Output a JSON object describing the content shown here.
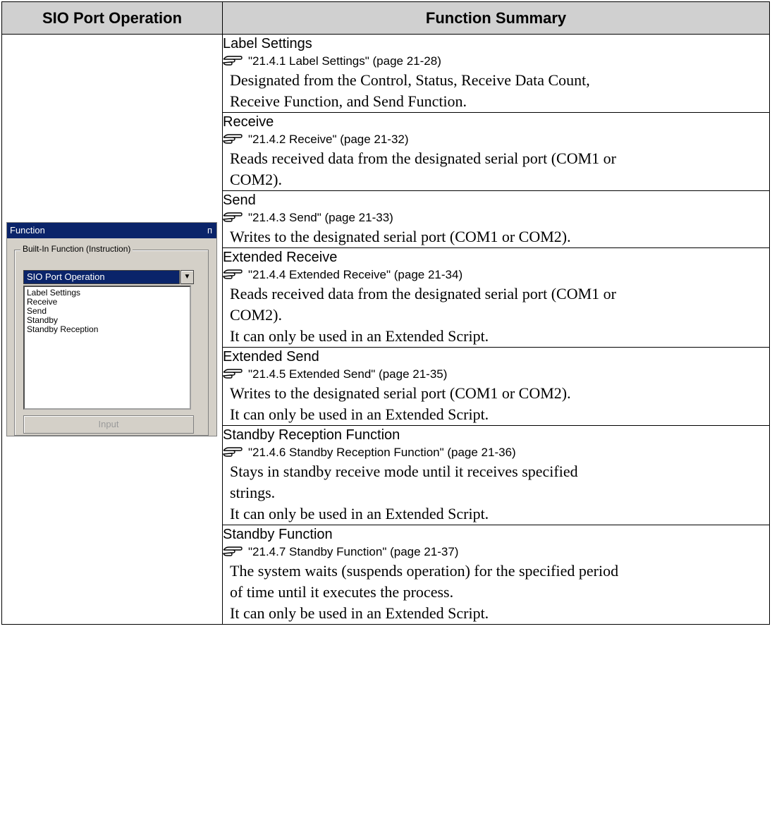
{
  "header": {
    "col1": "SIO Port Operation",
    "col2": "Function Summary"
  },
  "panel": {
    "title": "Function",
    "pin_glyph": "ᴨ",
    "group_label": "Built-In Function (Instruction)",
    "combo_value": "SIO Port Operation",
    "list_items": [
      "Label Settings",
      "Receive",
      "Send",
      "Standby",
      "Standby Reception"
    ],
    "input_button": "Input"
  },
  "rows": [
    {
      "name": "Label Settings",
      "ref": "\"21.4.1 Label Settings\" (page 21-28)",
      "lines": [
        "Designated from the Control, Status, Receive Data Count,",
        "Receive Function, and Send Function."
      ]
    },
    {
      "name": "Receive",
      "ref": "\"21.4.2 Receive\" (page 21-32)",
      "lines": [
        "Reads received data from the designated serial port (COM1 or",
        "COM2)."
      ]
    },
    {
      "name": "Send",
      "ref": "\"21.4.3 Send\" (page 21-33)",
      "lines": [
        "Writes to the designated serial port (COM1 or COM2)."
      ]
    },
    {
      "name": "Extended Receive",
      "ref": "\"21.4.4 Extended Receive\" (page 21-34)",
      "lines": [
        "Reads received data from the designated serial port (COM1 or",
        "COM2).",
        "It can only be used in an Extended Script."
      ]
    },
    {
      "name": "Extended Send",
      "ref": "\"21.4.5 Extended Send\" (page 21-35)",
      "lines": [
        "Writes to the designated serial port (COM1 or COM2).",
        "It can only be used in an Extended Script."
      ]
    },
    {
      "name": "Standby Reception Function",
      "ref": "\"21.4.6 Standby Reception Function\" (page 21-36)",
      "lines": [
        "Stays in standby receive mode until it receives specified",
        "strings.",
        "It can only be used in an Extended Script."
      ]
    },
    {
      "name": "Standby Function",
      "ref": "\"21.4.7 Standby Function\" (page 21-37)",
      "lines": [
        "The system waits (suspends operation) for the specified period",
        "of time until it executes the process.",
        "It can only be used in an Extended Script."
      ]
    }
  ]
}
